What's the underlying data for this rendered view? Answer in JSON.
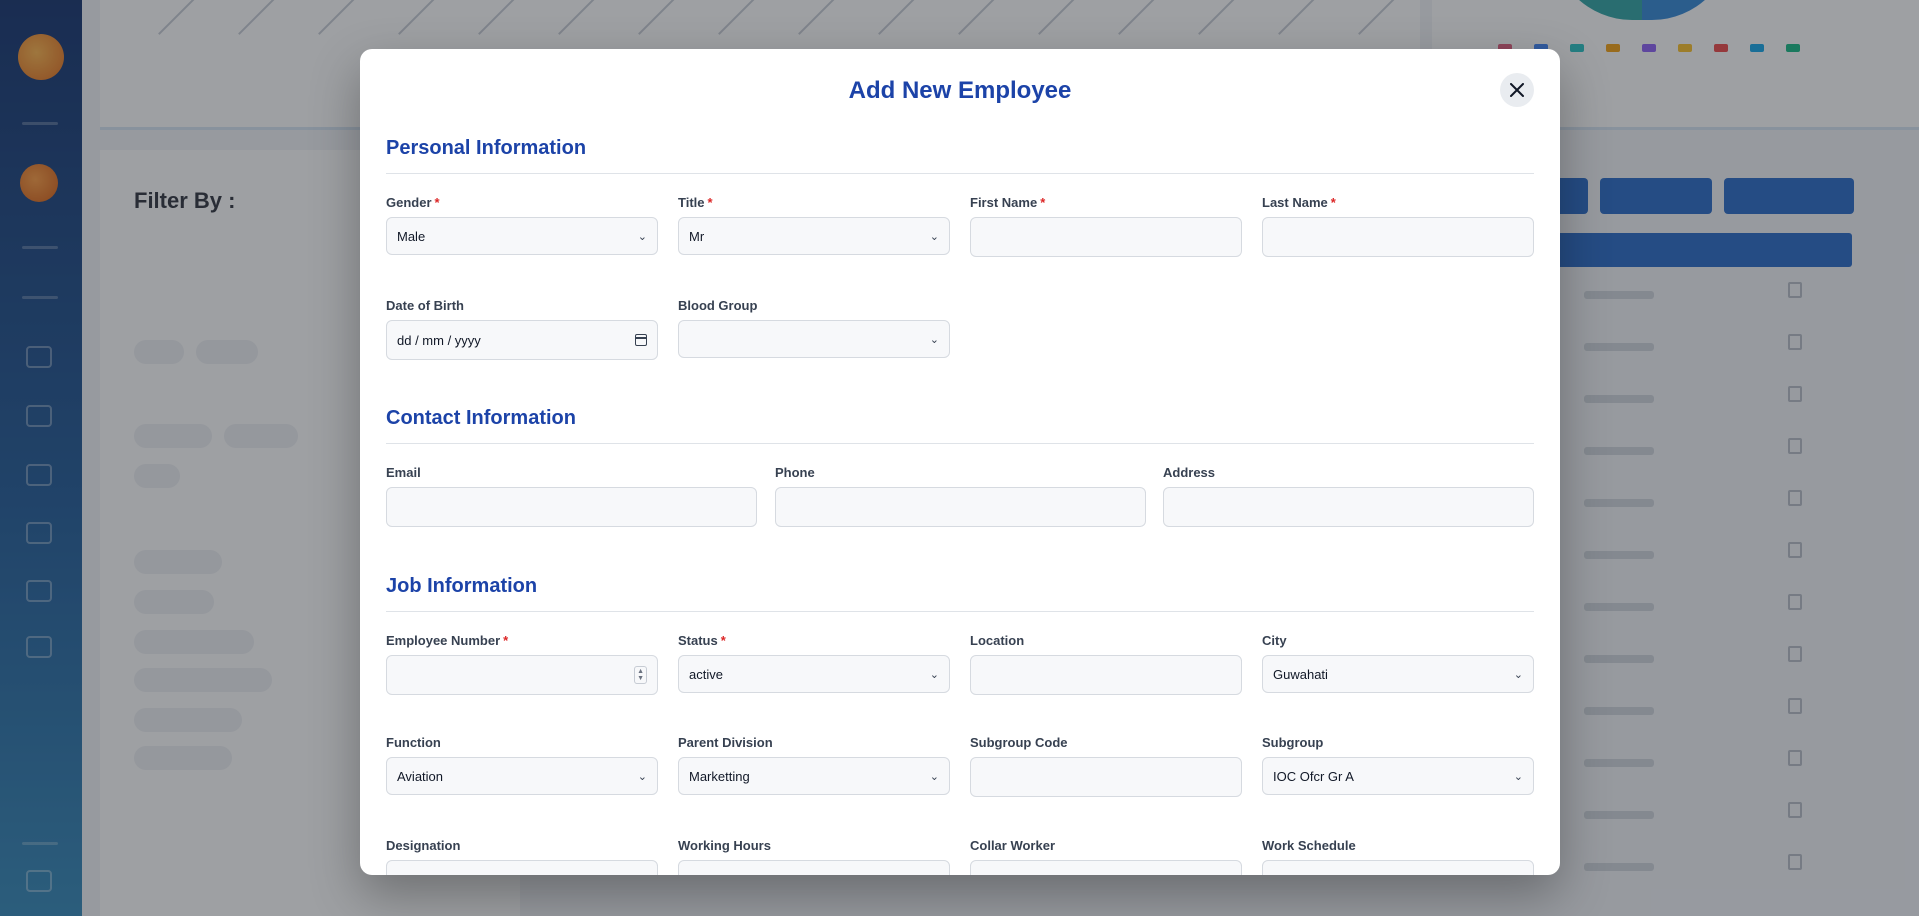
{
  "modal": {
    "title": "Add New Employee",
    "close_icon": "close-icon"
  },
  "sections": {
    "personal": "Personal Information",
    "contact": "Contact Information",
    "job": "Job Information"
  },
  "fields": {
    "gender": {
      "label": "Gender",
      "value": "Male",
      "required": true
    },
    "title": {
      "label": "Title",
      "value": "Mr",
      "required": true
    },
    "first_name": {
      "label": "First Name",
      "value": "",
      "required": true
    },
    "last_name": {
      "label": "Last Name",
      "value": "",
      "required": true
    },
    "dob": {
      "label": "Date of Birth",
      "placeholder": "dd / mm / yyyy"
    },
    "blood_group": {
      "label": "Blood Group",
      "value": ""
    },
    "email": {
      "label": "Email",
      "value": ""
    },
    "phone": {
      "label": "Phone",
      "value": ""
    },
    "address": {
      "label": "Address",
      "value": ""
    },
    "employee_number": {
      "label": "Employee Number",
      "value": "",
      "required": true
    },
    "status": {
      "label": "Status",
      "value": "active",
      "required": true
    },
    "location": {
      "label": "Location",
      "value": ""
    },
    "city": {
      "label": "City",
      "value": "Guwahati"
    },
    "function": {
      "label": "Function",
      "value": "Aviation"
    },
    "parent_division": {
      "label": "Parent Division",
      "value": "Marketting"
    },
    "subgroup_code": {
      "label": "Subgroup Code",
      "value": ""
    },
    "subgroup": {
      "label": "Subgroup",
      "value": "IOC Ofcr Gr A"
    },
    "designation": {
      "label": "Designation",
      "value": ""
    },
    "working_hours": {
      "label": "Working Hours",
      "value": ""
    },
    "collar_worker": {
      "label": "Collar Worker",
      "value": ""
    },
    "work_schedule": {
      "label": "Work Schedule",
      "value": ""
    }
  },
  "background": {
    "filter_title": "Filter By :",
    "colors": {
      "primary": "#1c43a8",
      "button": "#2467c6",
      "required": "#dc2626"
    }
  }
}
